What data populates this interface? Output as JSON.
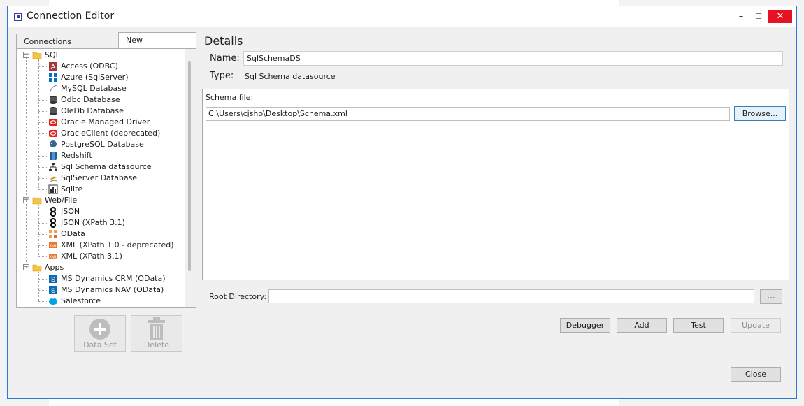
{
  "window": {
    "title": "Connection Editor",
    "min": "–",
    "max": "☐",
    "close": "✕"
  },
  "tabs": [
    {
      "label": "Connections"
    },
    {
      "label": "New"
    }
  ],
  "tree": {
    "groups": [
      {
        "label": "SQL",
        "items": [
          {
            "label": "Access (ODBC)",
            "icon": "access-icon"
          },
          {
            "label": "Azure (SqlServer)",
            "icon": "azure-icon"
          },
          {
            "label": "MySQL Database",
            "icon": "mysql-icon"
          },
          {
            "label": "Odbc Database",
            "icon": "database-icon"
          },
          {
            "label": "OleDb Database",
            "icon": "database-icon"
          },
          {
            "label": "Oracle Managed Driver",
            "icon": "oracle-icon"
          },
          {
            "label": "OracleClient (deprecated)",
            "icon": "oracle-icon"
          },
          {
            "label": "PostgreSQL Database",
            "icon": "postgres-icon"
          },
          {
            "label": "Redshift",
            "icon": "redshift-icon"
          },
          {
            "label": "Sql Schema datasource",
            "icon": "schema-icon"
          },
          {
            "label": "SqlServer Database",
            "icon": "sqlserver-icon"
          },
          {
            "label": "Sqlite",
            "icon": "sqlite-icon"
          }
        ]
      },
      {
        "label": "Web/File",
        "items": [
          {
            "label": "JSON",
            "icon": "json-icon"
          },
          {
            "label": "JSON (XPath 3.1)",
            "icon": "json-icon"
          },
          {
            "label": "OData",
            "icon": "odata-icon"
          },
          {
            "label": "XML (XPath 1.0 - deprecated)",
            "icon": "xml-icon"
          },
          {
            "label": "XML (XPath 3.1)",
            "icon": "xml-icon"
          }
        ]
      },
      {
        "label": "Apps",
        "items": [
          {
            "label": "MS Dynamics CRM (OData)",
            "icon": "dynamics-icon"
          },
          {
            "label": "MS Dynamics NAV (OData)",
            "icon": "dynamics-icon"
          },
          {
            "label": "Salesforce",
            "icon": "salesforce-icon"
          }
        ]
      }
    ]
  },
  "actions": {
    "dataset": "Data Set",
    "delete": "Delete"
  },
  "details": {
    "title": "Details",
    "name_label": "Name:",
    "name_value": "SqlSchemaDS",
    "type_label": "Type:",
    "type_value": "Sql Schema datasource",
    "schema_label": "Schema file:",
    "schema_value": "C:\\Users\\cjsho\\Desktop\\Schema.xml",
    "browse": "Browse...",
    "root_label": "Root Directory:",
    "root_value": "",
    "root_dots": "...",
    "debugger": "Debugger",
    "add": "Add",
    "test": "Test",
    "update": "Update",
    "close": "Close"
  },
  "colors": {
    "accent": "#2b79d6",
    "close_red": "#e81123",
    "folder": "#f5c542"
  }
}
